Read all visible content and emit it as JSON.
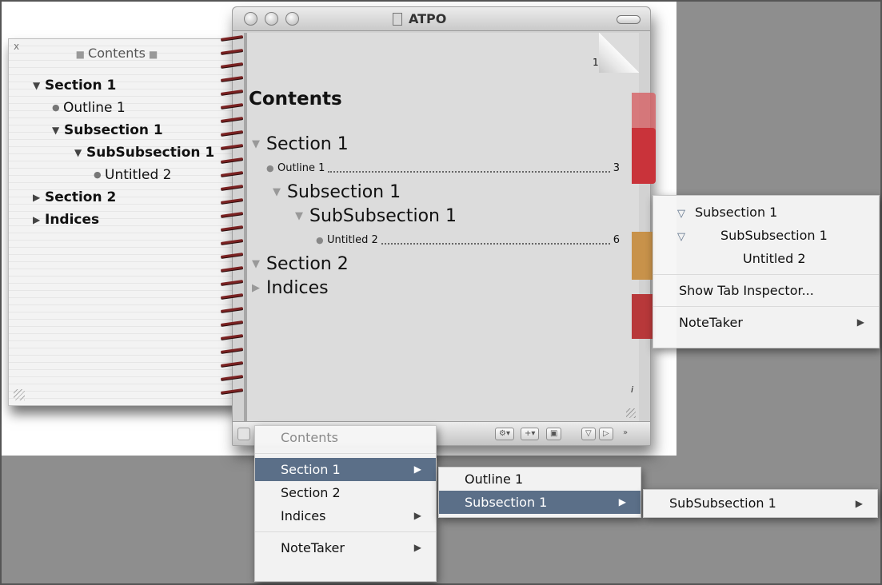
{
  "drawer": {
    "close_label": "x",
    "title": "Contents",
    "items": [
      {
        "label": "Section 1",
        "kind": "section",
        "expanded": true
      },
      {
        "label": "Outline 1",
        "kind": "leaf"
      },
      {
        "label": "Subsection 1",
        "kind": "section",
        "expanded": true
      },
      {
        "label": "SubSubsection 1",
        "kind": "section",
        "expanded": true
      },
      {
        "label": "Untitled 2",
        "kind": "leaf"
      },
      {
        "label": "Section 2",
        "kind": "section",
        "expanded": false
      },
      {
        "label": "Indices",
        "kind": "section",
        "expanded": false
      }
    ]
  },
  "window": {
    "title": "ATPO",
    "page_number": "1",
    "contents_heading": "Contents",
    "corner_mark": "i",
    "toc": [
      {
        "label": "Section 1",
        "page": ""
      },
      {
        "label": "Outline 1",
        "page": "3"
      },
      {
        "label": "Subsection 1",
        "page": ""
      },
      {
        "label": "SubSubsection 1",
        "page": ""
      },
      {
        "label": "Untitled 2",
        "page": "6"
      },
      {
        "label": "Section 2",
        "page": ""
      },
      {
        "label": "Indices",
        "page": ""
      }
    ],
    "toolbar": {
      "gear": "⚙▾",
      "add": "+▾",
      "save": "▣",
      "filter": "▽",
      "play": "▷",
      "more": "»"
    }
  },
  "tab_menu": {
    "items": [
      "Subsection 1",
      "SubSubsection 1",
      "Untitled 2"
    ],
    "inspector": "Show Tab Inspector...",
    "notetaker": "NoteTaker"
  },
  "nav_menu": {
    "header": "Contents",
    "items": [
      "Section 1",
      "Section 2",
      "Indices"
    ],
    "notetaker": "NoteTaker"
  },
  "sub_menu": {
    "items": [
      "Outline 1",
      "Subsection 1"
    ]
  },
  "subsub_menu": {
    "items": [
      "SubSubsection 1"
    ]
  },
  "colors": {
    "menu_highlight": "#5b6f88",
    "tab_red": "#c9333a",
    "tab_tan": "#c8924a",
    "spiral": "#7a2222"
  }
}
